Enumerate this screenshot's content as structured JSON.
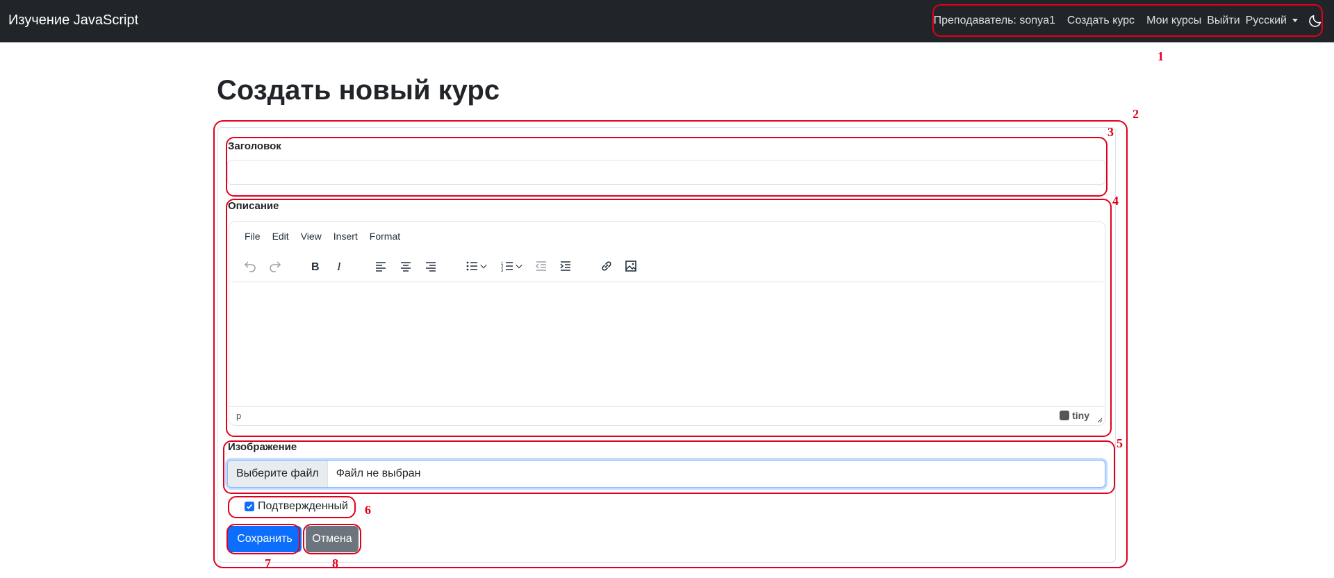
{
  "navbar": {
    "brand": "Изучение JavaScript",
    "teacher": "Преподаватель: sonya1",
    "create_course": "Создать курс",
    "my_courses": "Мои курсы",
    "logout": "Выйти",
    "language": "Русский",
    "theme_icon": "moon-icon"
  },
  "page": {
    "title": "Создать новый курс"
  },
  "form": {
    "title_label": "Заголовок",
    "title_value": "",
    "description_label": "Описание",
    "editor": {
      "menu": [
        "File",
        "Edit",
        "View",
        "Insert",
        "Format"
      ],
      "status_path": "p",
      "brand": "tiny",
      "toolbar_icons": [
        "undo-icon",
        "redo-icon",
        "bold-icon",
        "italic-icon",
        "align-left-icon",
        "align-center-icon",
        "align-right-icon",
        "bullet-list-icon",
        "numbered-list-icon",
        "outdent-icon",
        "indent-icon",
        "link-icon",
        "image-icon"
      ]
    },
    "image_label": "Изображение",
    "file_button": "Выберите файл",
    "file_status": "Файл не выбран",
    "approved_label": "Подтвержденный",
    "approved_checked": true,
    "save_button": "Сохранить",
    "cancel_button": "Отмена"
  },
  "annotations": [
    "1",
    "2",
    "3",
    "4",
    "5",
    "6",
    "7",
    "8"
  ],
  "colors": {
    "navbar_bg": "#212529",
    "primary": "#0d6efd",
    "secondary": "#6c757d",
    "annotation": "#e0001b"
  }
}
